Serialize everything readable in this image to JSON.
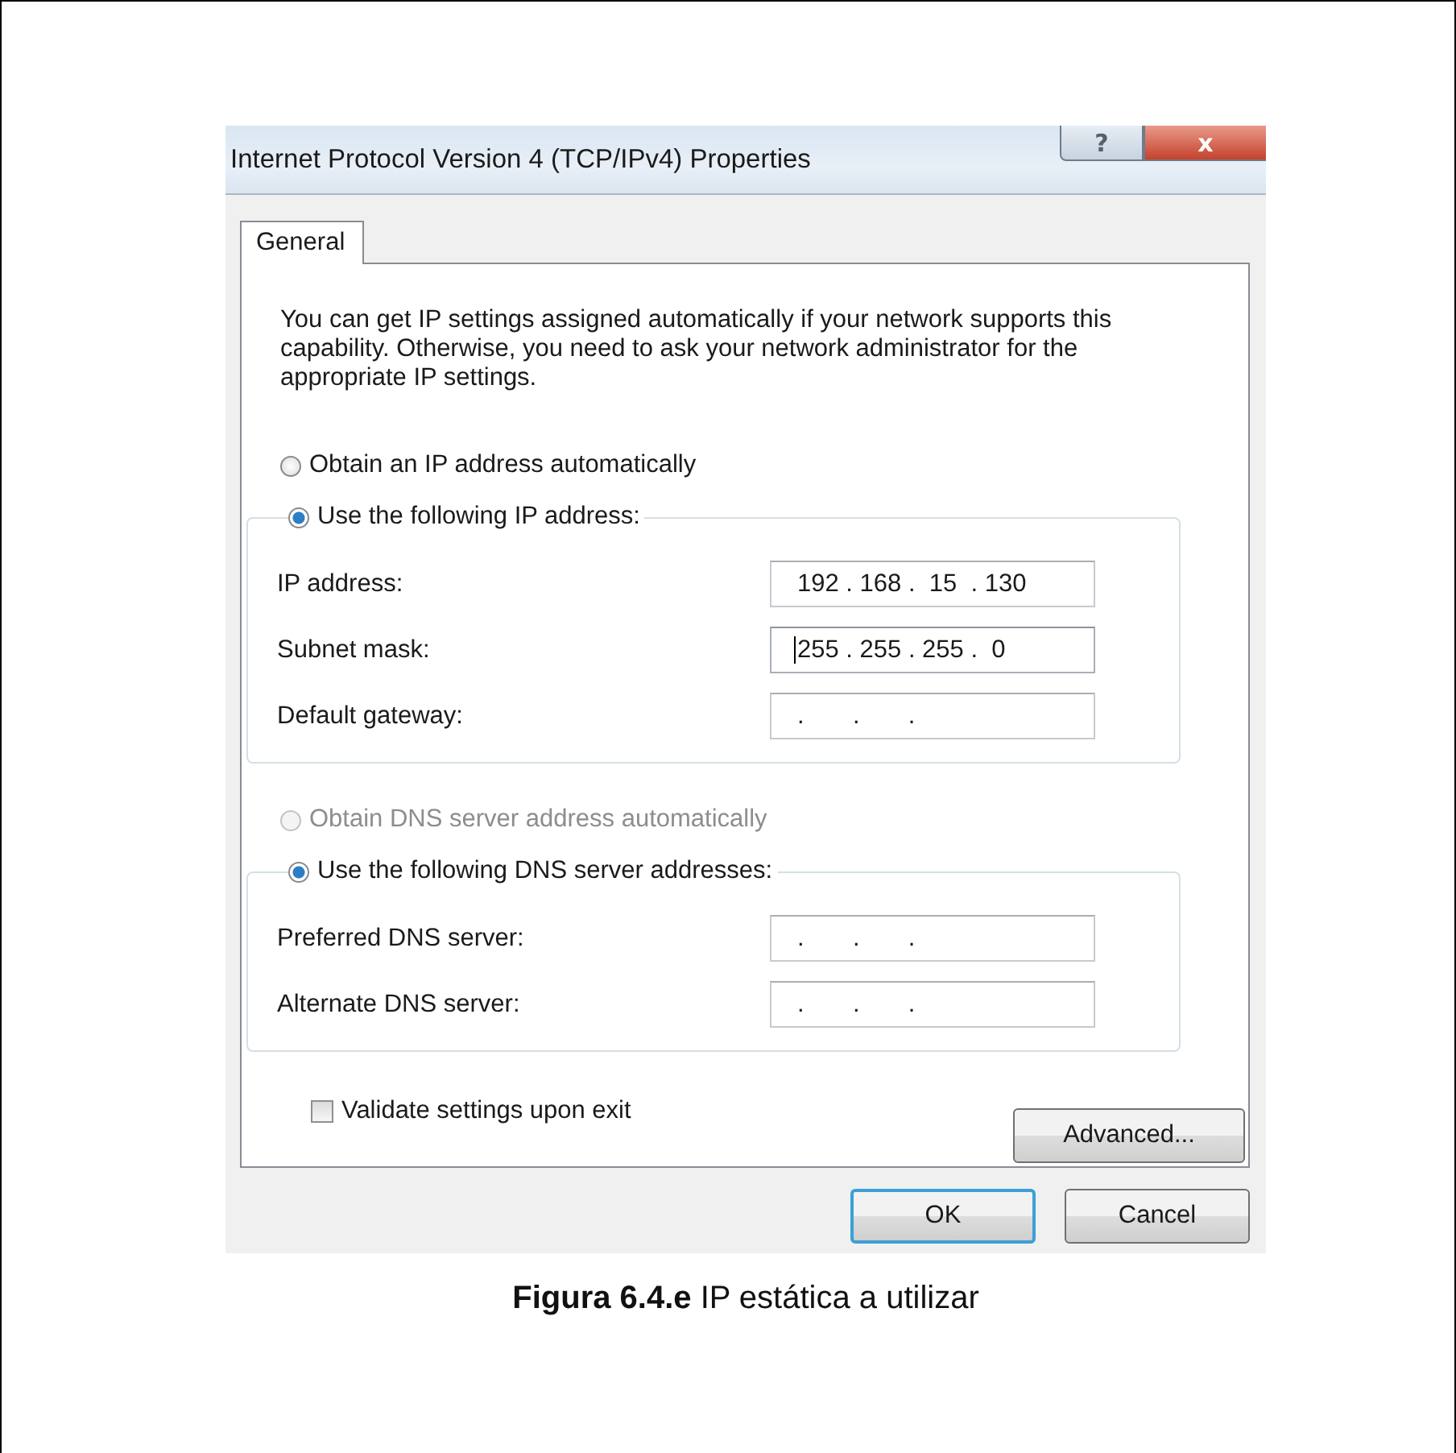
{
  "window": {
    "title": "Internet Protocol Version 4 (TCP/IPv4) Properties"
  },
  "title_buttons": [
    {
      "kind": "help",
      "glyph": "?"
    },
    {
      "kind": "close",
      "glyph": "x"
    }
  ],
  "tabs": [
    {
      "label": "General",
      "selected": true
    }
  ],
  "description": "You can get IP settings assigned automatically if your network supports this capability. Otherwise, you need to ask your network administrator for the appropriate IP settings.",
  "sections": [
    {
      "auto": {
        "label": "Obtain an IP address automatically",
        "selected": false,
        "disabled": false
      },
      "manual": {
        "label": "Use the following IP address:",
        "selected": true,
        "disabled": false
      },
      "fields": [
        {
          "label": "IP address:",
          "value": "192 . 168 .  15  . 130",
          "focused": false
        },
        {
          "label": "Subnet mask:",
          "value": "255 . 255 . 255 .  0",
          "focused": true
        },
        {
          "label": "Default gateway:",
          "value": ".       .       .",
          "focused": false
        }
      ]
    },
    {
      "auto": {
        "label": "Obtain DNS server address automatically",
        "selected": false,
        "disabled": true
      },
      "manual": {
        "label": "Use the following DNS server addresses:",
        "selected": true,
        "disabled": false
      },
      "fields": [
        {
          "label": "Preferred DNS server:",
          "value": ".       .       .",
          "focused": false
        },
        {
          "label": "Alternate DNS server:",
          "value": ".       .       .",
          "focused": false
        }
      ]
    }
  ],
  "validate": {
    "label": "Validate settings upon exit",
    "checked": false
  },
  "advanced_button": "Advanced...",
  "buttons": [
    {
      "label": "OK",
      "default": true
    },
    {
      "label": "Cancel",
      "default": false
    }
  ],
  "caption": "**Figura 6.4.e** IP estática a utilizar"
}
